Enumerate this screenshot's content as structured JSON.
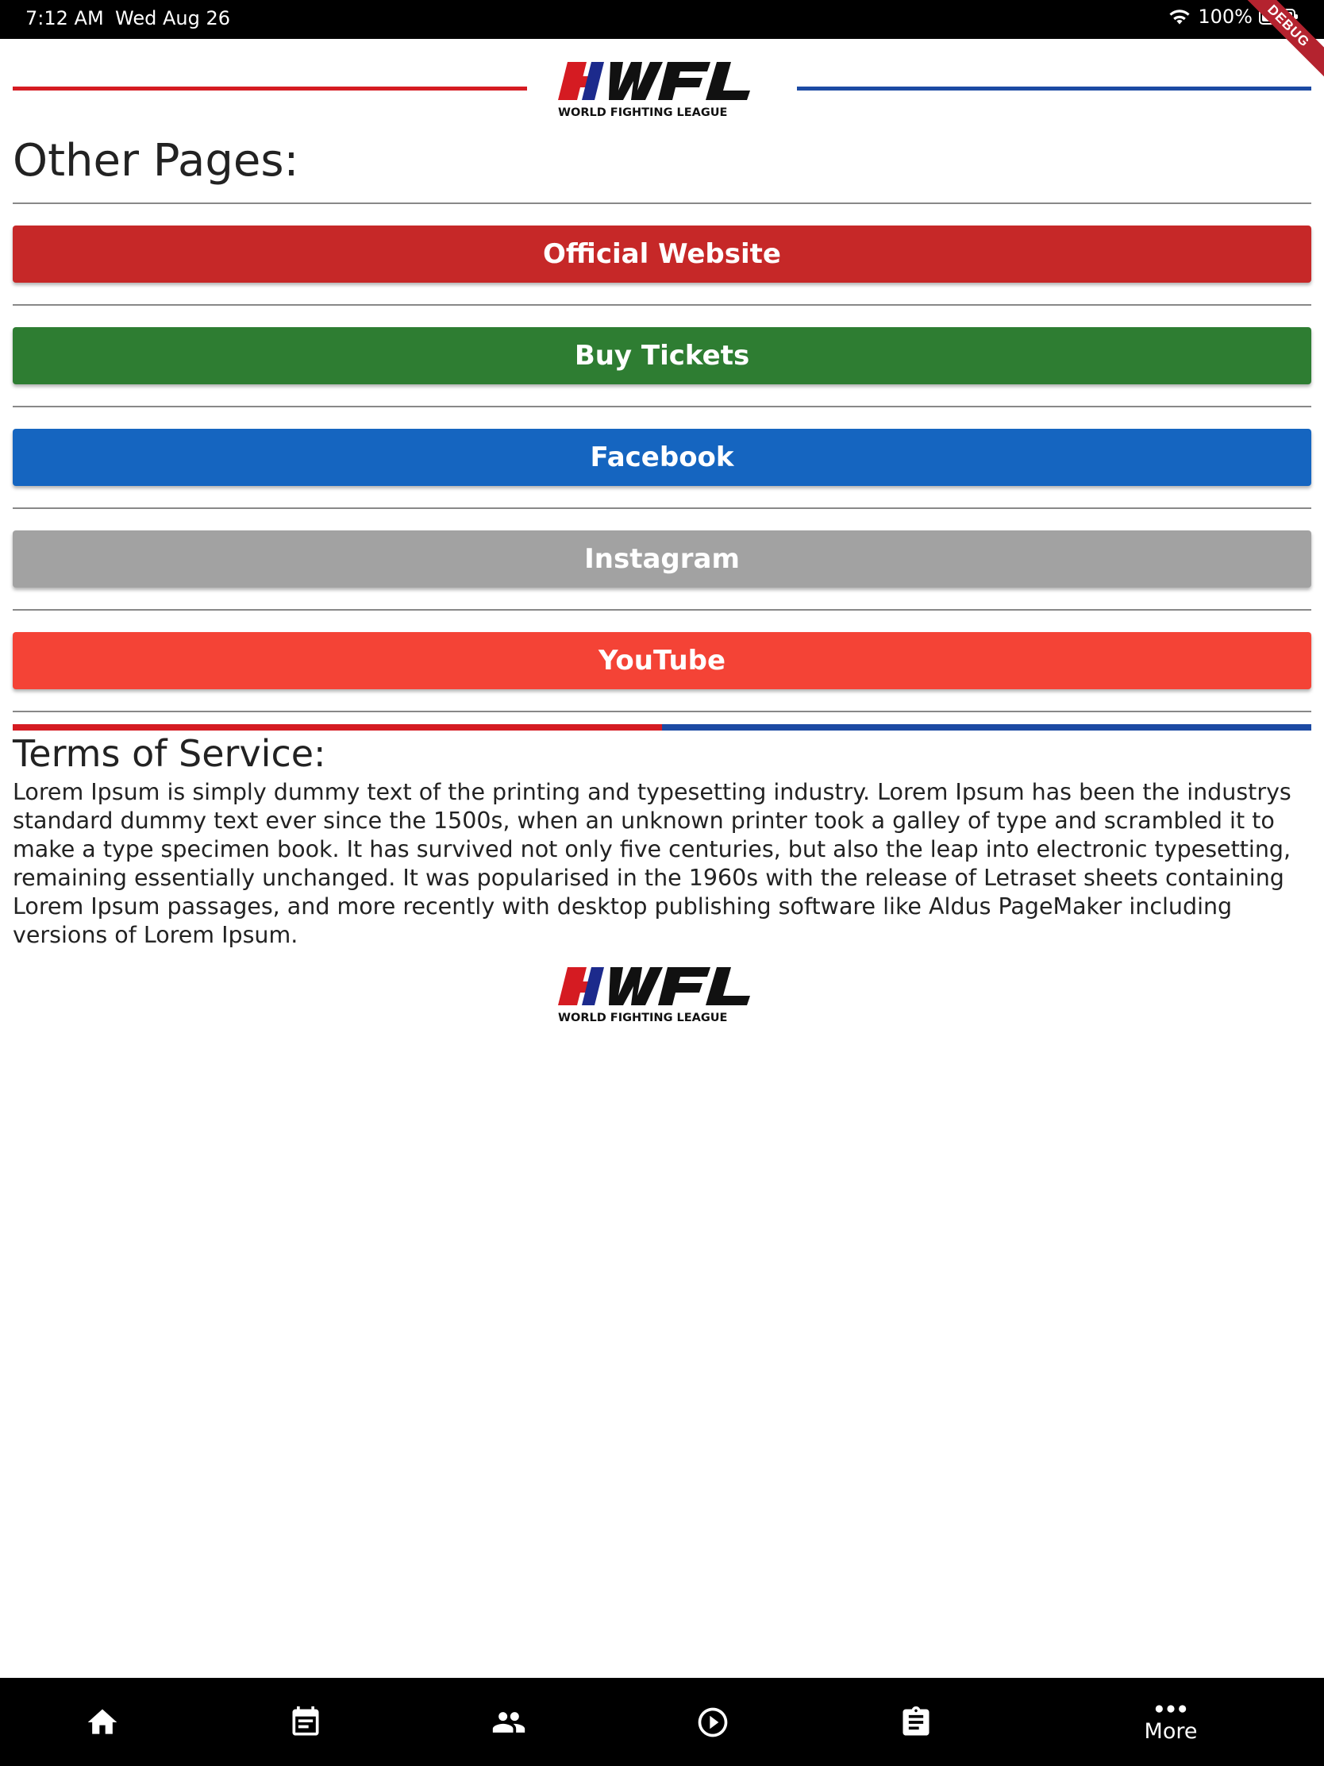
{
  "status_bar": {
    "time": "7:12 AM",
    "date": "Wed Aug 26",
    "battery": "100%",
    "debug_banner": "DEBUG"
  },
  "brand": {
    "logo_text": "WFL",
    "logo_tagline": "WORLD FIGHTING LEAGUE",
    "red": "#d51b22",
    "blue": "#1c4aa3"
  },
  "other_pages": {
    "heading": "Other Pages:",
    "buttons": [
      {
        "label": "Official Website",
        "color": "#c62828"
      },
      {
        "label": "Buy Tickets",
        "color": "#2e7d32"
      },
      {
        "label": "Facebook",
        "color": "#1565c0"
      },
      {
        "label": "Instagram",
        "color": "#a2a2a2"
      },
      {
        "label": "YouTube",
        "color": "#f44336"
      }
    ]
  },
  "terms": {
    "heading": "Terms of Service:",
    "body": "Lorem Ipsum is simply dummy text of the printing and typesetting industry. Lorem Ipsum has been the industrys standard dummy text ever since the 1500s, when an unknown printer took a galley of type and scrambled it to make a type specimen book. It has survived not only five centuries, but also the leap into electronic typesetting, remaining essentially unchanged. It was popularised in the 1960s with the release of Letraset sheets containing Lorem Ipsum passages, and more recently with desktop publishing software like Aldus PageMaker including versions of Lorem Ipsum."
  },
  "bottom_nav": {
    "items": [
      {
        "icon": "home-icon"
      },
      {
        "icon": "calendar-icon"
      },
      {
        "icon": "people-icon"
      },
      {
        "icon": "play-circle-icon"
      },
      {
        "icon": "clipboard-icon"
      },
      {
        "icon": "more-dots-icon",
        "label": "More"
      }
    ]
  }
}
